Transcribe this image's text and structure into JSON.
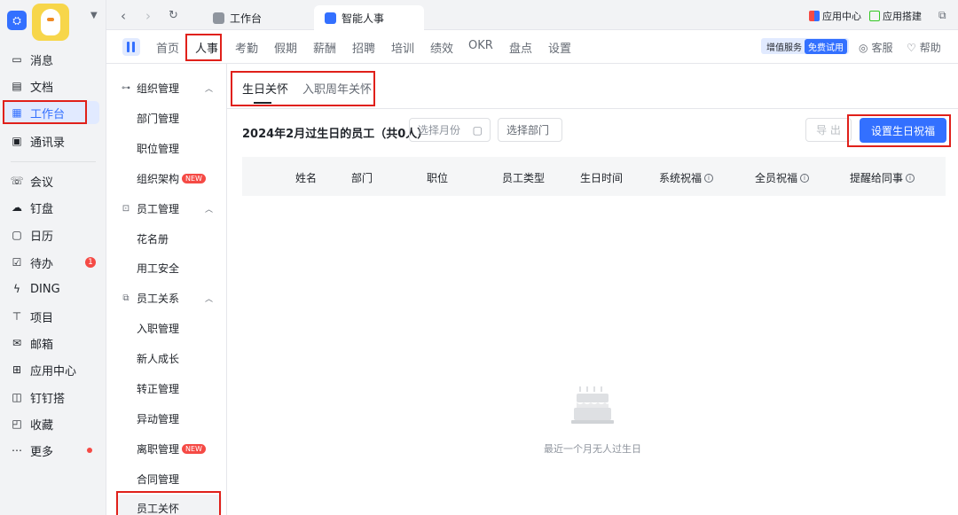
{
  "app_sidebar": {
    "items": [
      {
        "label": "消息",
        "icon": "message-icon"
      },
      {
        "label": "文档",
        "icon": "document-icon"
      },
      {
        "label": "工作台",
        "icon": "grid-icon"
      },
      {
        "label": "通讯录",
        "icon": "contacts-icon"
      },
      {
        "label": "会议",
        "icon": "meeting-icon"
      },
      {
        "label": "钉盘",
        "icon": "cloud-icon"
      },
      {
        "label": "日历",
        "icon": "calendar-icon"
      },
      {
        "label": "待办",
        "icon": "todo-icon",
        "badge": "1"
      },
      {
        "label": "DING",
        "icon": "ding-icon"
      },
      {
        "label": "项目",
        "icon": "project-icon"
      },
      {
        "label": "邮箱",
        "icon": "mail-icon"
      },
      {
        "label": "应用中心",
        "icon": "apps-icon"
      },
      {
        "label": "钉钉搭",
        "icon": "builder-icon"
      },
      {
        "label": "收藏",
        "icon": "favorite-icon"
      },
      {
        "label": "更多",
        "icon": "more-icon"
      }
    ]
  },
  "tabs": {
    "items": [
      {
        "label": "工作台"
      },
      {
        "label": "智能人事"
      }
    ],
    "app_center": "应用中心",
    "app_builder": "应用搭建"
  },
  "module_nav": {
    "items": [
      "首页",
      "人事",
      "考勤",
      "假期",
      "薪酬",
      "招聘",
      "培训",
      "绩效",
      "OKR",
      "盘点",
      "设置"
    ],
    "value_service": "增值服务",
    "free_trial": "免费试用",
    "support": "客服",
    "help": "帮助"
  },
  "sub_sidebar": {
    "groups": [
      {
        "label": "组织管理",
        "items": [
          "部门管理",
          "职位管理",
          "组织架构"
        ]
      },
      {
        "label": "员工管理",
        "items": [
          "花名册",
          "用工安全"
        ]
      },
      {
        "label": "员工关系",
        "items": [
          "入职管理",
          "新人成长",
          "转正管理",
          "异动管理",
          "离职管理",
          "合同管理",
          "员工关怀"
        ]
      }
    ],
    "new_badge": "NEW"
  },
  "content": {
    "tabs": [
      "生日关怀",
      "入职周年关怀"
    ],
    "heading": "2024年2月过生日的员工（共0人）",
    "month_placeholder": "选择月份",
    "dept_placeholder": "选择部门",
    "export_label": "导 出",
    "primary_label": "设置生日祝福",
    "columns": [
      "姓名",
      "部门",
      "职位",
      "员工类型",
      "生日时间",
      "系统祝福",
      "全员祝福",
      "提醒给同事"
    ],
    "info_mark": "i",
    "empty_text": "最近一个月无人过生日"
  },
  "colors": {
    "accent": "#3370ff",
    "highlight": "#e0201a",
    "badge": "#f54a45"
  }
}
